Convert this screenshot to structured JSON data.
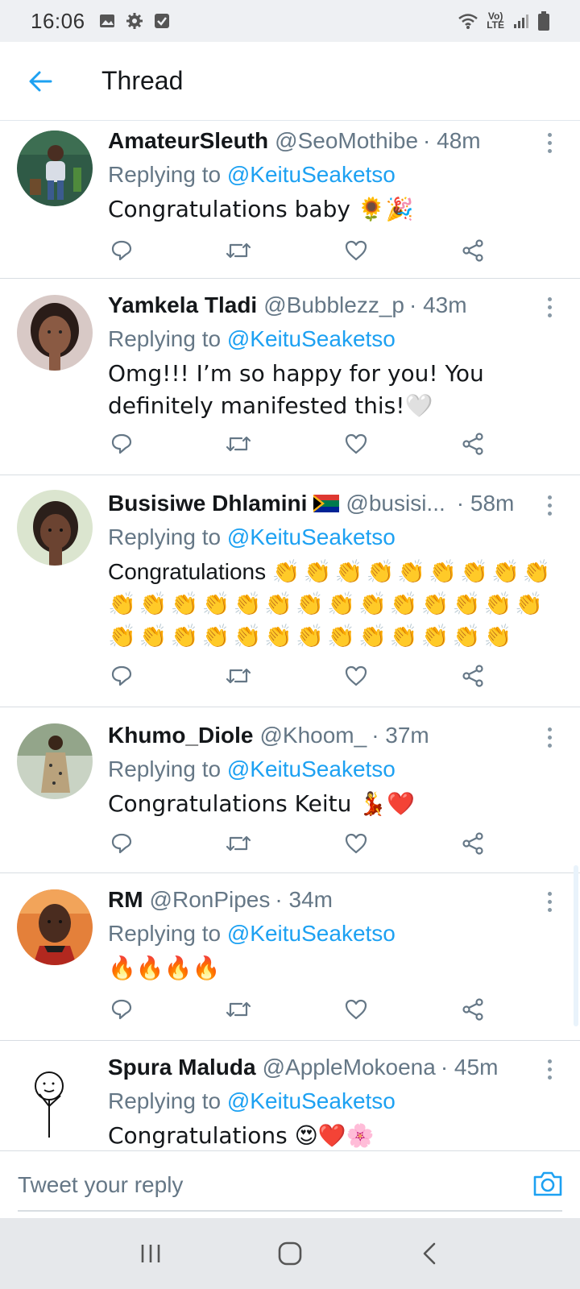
{
  "status_bar": {
    "time": "16:06",
    "lte_top": "Vo)",
    "lte_bottom": "LTE",
    "left_icons": [
      "image-icon",
      "gear-icon",
      "checkbox-icon"
    ],
    "right_icons": [
      "wifi-icon",
      "signal-icon",
      "battery-icon"
    ]
  },
  "header": {
    "title": "Thread",
    "back_icon": "arrow-left-icon",
    "accent": "#1da1f2"
  },
  "tweets": [
    {
      "name": "AmateurSleuth",
      "handle": "@SeoMothibe",
      "time": "· 48m",
      "replying_prefix": "Replying to ",
      "replying_to": "@KeituSeaketso",
      "text": "Congratulations baby 🌻🎉"
    },
    {
      "name": "Yamkela Tladi",
      "handle": "@Bubblezz_p",
      "time": "· 43m",
      "replying_prefix": "Replying to ",
      "replying_to": "@KeituSeaketso",
      "text": "Omg!!! I’m so happy for you! You definitely manifested this!🤍"
    },
    {
      "name": "Busisiwe Dhlamini",
      "handle": "@busisi...",
      "time": "· 58m",
      "replying_prefix": "Replying to ",
      "replying_to": "@KeituSeaketso",
      "text": "Congratulations",
      "clap_count": 36
    },
    {
      "name": "Khumo_Diole",
      "handle": "@Khoom_",
      "time": "· 37m",
      "replying_prefix": "Replying to ",
      "replying_to": "@KeituSeaketso",
      "text": "Congratulations Keitu 💃❤️"
    },
    {
      "name": "RM",
      "handle": "@RonPipes",
      "time": "· 34m",
      "replying_prefix": "Replying to ",
      "replying_to": "@KeituSeaketso",
      "text": "🔥🔥🔥🔥"
    },
    {
      "name": "Spura Maluda",
      "handle": "@AppleMokoena",
      "time": "· 45m",
      "replying_prefix": "Replying to ",
      "replying_to": "@KeituSeaketso",
      "text": "Congratulations 😍❤️🌸"
    }
  ],
  "actions": [
    "reply-icon",
    "retweet-icon",
    "like-icon",
    "share-icon"
  ],
  "reply_bar": {
    "placeholder": "Tweet your reply",
    "camera_icon": "camera-icon"
  },
  "nav_bar": [
    "recents-icon",
    "home-icon",
    "back-icon"
  ]
}
